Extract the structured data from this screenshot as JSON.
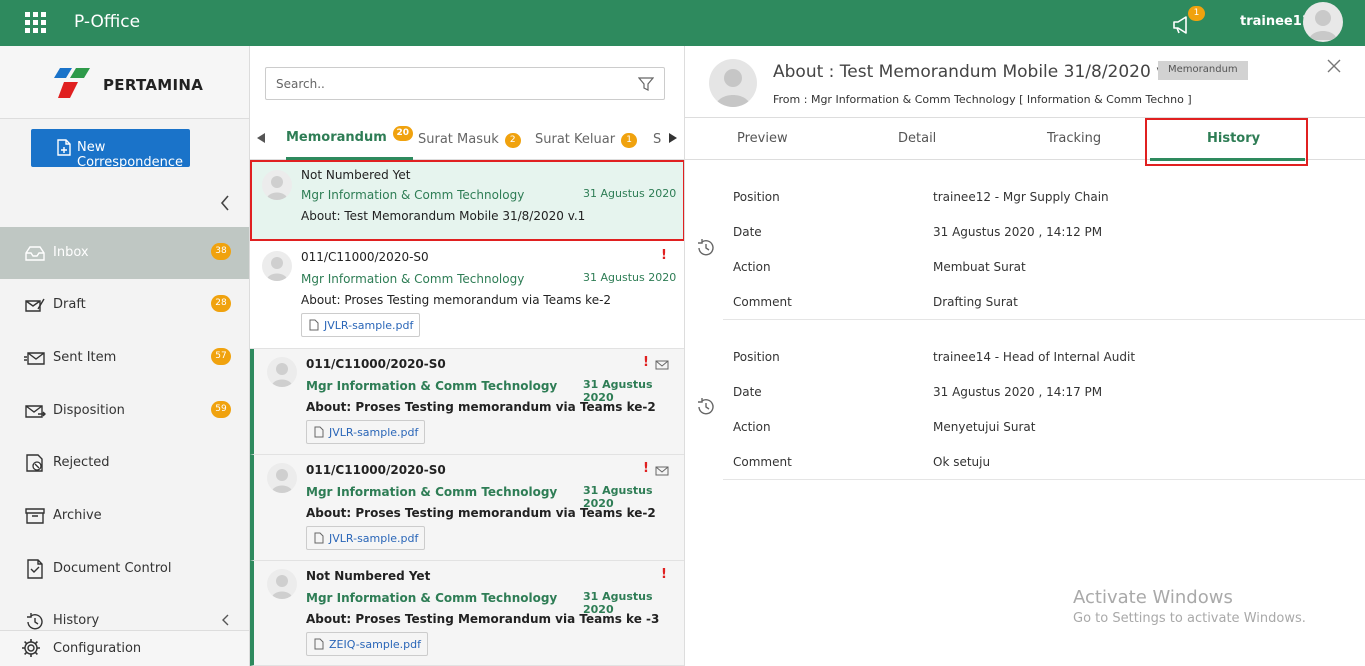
{
  "app": {
    "title": "P-Office"
  },
  "header": {
    "notification_count": "1",
    "username": "trainee11"
  },
  "sidebar": {
    "logo_text": "PERTAMINA",
    "new_button": "New Correspondence",
    "items": [
      {
        "label": "Inbox",
        "badge": "38"
      },
      {
        "label": "Draft",
        "badge": "28"
      },
      {
        "label": "Sent Item",
        "badge": "57"
      },
      {
        "label": "Disposition",
        "badge": "59"
      },
      {
        "label": "Rejected"
      },
      {
        "label": "Archive"
      },
      {
        "label": "Document Control"
      },
      {
        "label": "History"
      }
    ],
    "config_label": "Configuration"
  },
  "list": {
    "search_placeholder": "Search..",
    "tabs": [
      {
        "label": "Memorandum",
        "count": "20"
      },
      {
        "label": "Surat Masuk",
        "count": "2"
      },
      {
        "label": "Surat Keluar",
        "count": "1"
      },
      {
        "label": "S"
      }
    ],
    "items": [
      {
        "number": "Not Numbered Yet",
        "from": "Mgr Information & Comm Technology",
        "date": "31 Agustus 2020",
        "about": "About: Test Memorandum Mobile 31/8/2020 v.1"
      },
      {
        "number": "011/C11000/2020-S0",
        "from": "Mgr Information & Comm Technology",
        "date": "31 Agustus 2020",
        "about": "About: Proses Testing memorandum via Teams ke-2",
        "attachment": "JVLR-sample.pdf",
        "urgent": "!"
      },
      {
        "number": "011/C11000/2020-S0",
        "from": "Mgr Information & Comm Technology",
        "date": "31 Agustus 2020",
        "about": "About: Proses Testing memorandum via Teams ke-2",
        "attachment": "JVLR-sample.pdf",
        "urgent": "!"
      },
      {
        "number": "011/C11000/2020-S0",
        "from": "Mgr Information & Comm Technology",
        "date": "31 Agustus 2020",
        "about": "About: Proses Testing memorandum via Teams ke-2",
        "attachment": "JVLR-sample.pdf",
        "urgent": "!"
      },
      {
        "number": "Not Numbered Yet",
        "from": "Mgr Information & Comm Technology",
        "date": "31 Agustus 2020",
        "about": "About: Proses Testing Memorandum via Teams ke -3",
        "attachment": "ZEIQ-sample.pdf",
        "urgent": "!"
      }
    ]
  },
  "detail": {
    "title": "About : Test Memorandum Mobile 31/8/2020 v.1",
    "type_badge": "Memorandum",
    "from": "From : Mgr Information & Comm Technology [ Information & Comm Techno ]",
    "tabs": [
      "Preview",
      "Detail",
      "Tracking",
      "History"
    ],
    "history": [
      {
        "position_label": "Position",
        "position": "trainee12 - Mgr Supply Chain",
        "date_label": "Date",
        "date": "31 Agustus 2020 , 14:12 PM",
        "action_label": "Action",
        "action": "Membuat Surat",
        "comment_label": "Comment",
        "comment": "Drafting Surat"
      },
      {
        "position_label": "Position",
        "position": "trainee14 - Head of Internal Audit",
        "date_label": "Date",
        "date": "31 Agustus 2020 , 14:17 PM",
        "action_label": "Action",
        "action": "Menyetujui Surat",
        "comment_label": "Comment",
        "comment": "Ok setuju"
      }
    ]
  },
  "watermark": {
    "line1": "Activate Windows",
    "line2": "Go to Settings to activate Windows."
  },
  "colors": {
    "brand_green": "#2e8a5e",
    "accent_blue": "#1a73c9",
    "badge_orange": "#f0a20e",
    "highlight_red": "#e02020"
  }
}
